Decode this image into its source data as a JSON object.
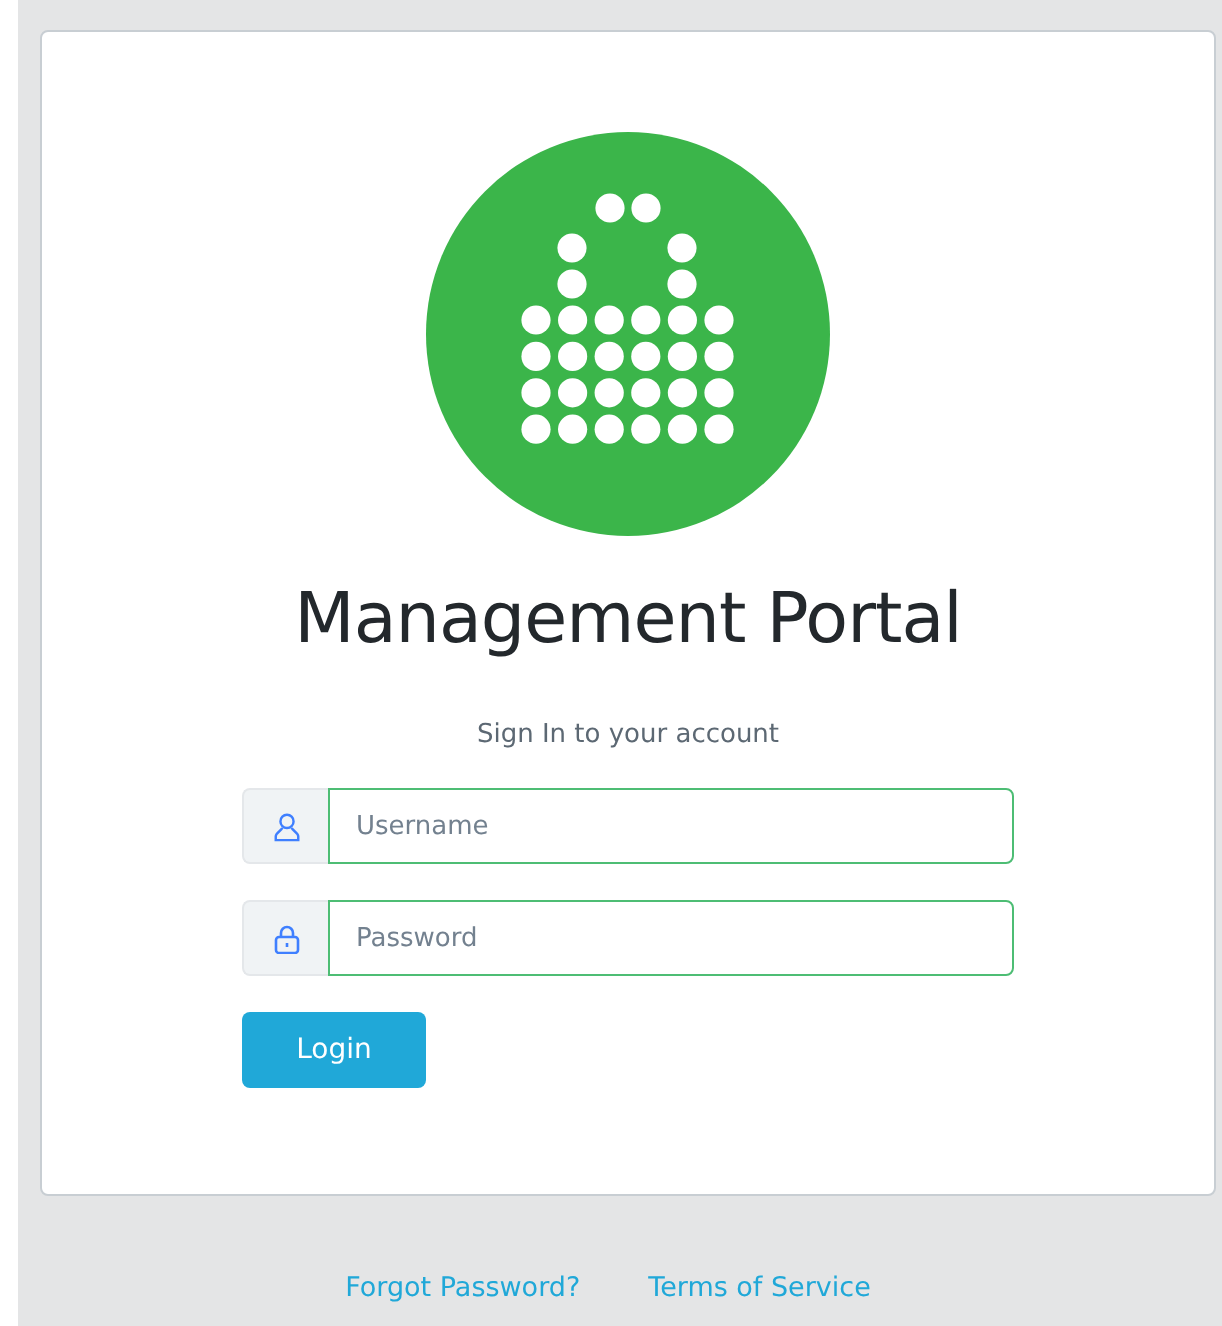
{
  "title": "Management Portal",
  "subtitle": "Sign In to your account",
  "fields": [
    {
      "kind": "user",
      "placeholder": "Username"
    },
    {
      "kind": "lock",
      "placeholder": "Password"
    }
  ],
  "login_button": "Login",
  "footer_links": [
    "Forgot Password?",
    "Terms of Service"
  ]
}
